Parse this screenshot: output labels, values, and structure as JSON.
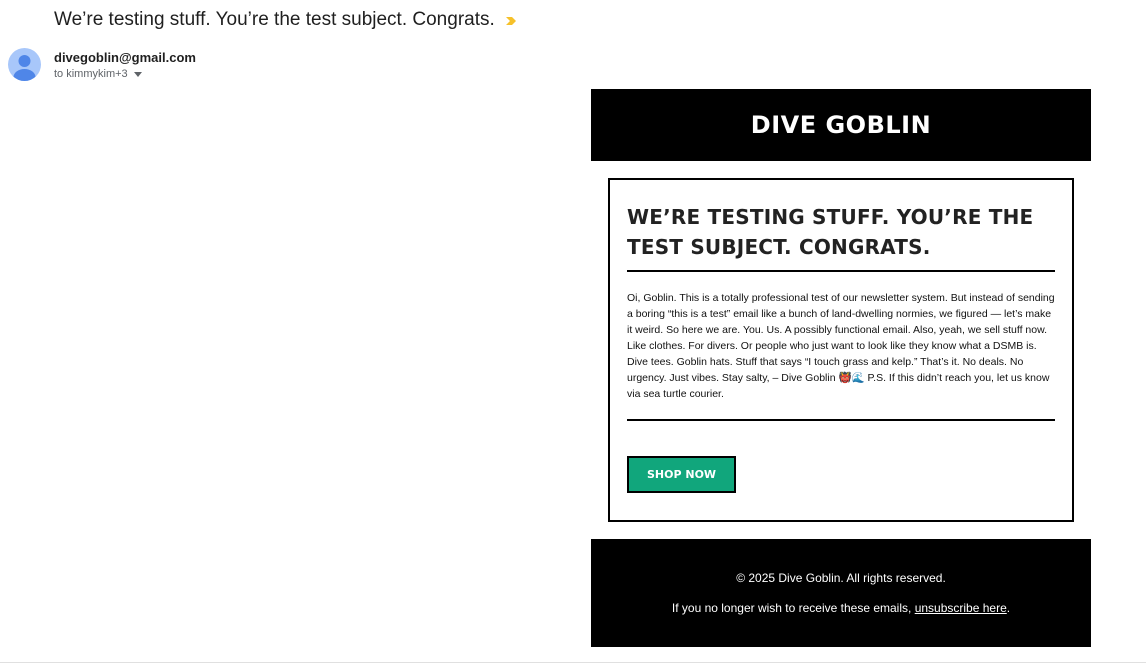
{
  "email": {
    "subject": "We’re testing stuff. You’re the test subject. Congrats.",
    "importance_icon": "importance-marker-icon",
    "importance_color": "#f6c12a",
    "sender": "divegoblin@gmail.com",
    "recipients": "to kimmykim+3",
    "avatar_color": "#a8c7fa"
  },
  "newsletter": {
    "brand": "DIVE GOBLIN",
    "headline": "WE’RE TESTING STUFF. YOU’RE THE TEST SUBJECT. CONGRATS.",
    "body": "Oi, Goblin. This is a totally professional test of our newsletter system. But instead of sending a boring “this is a test” email like a bunch of land-dwelling normies, we figured — let’s make it weird. So here we are. You. Us. A possibly functional email. Also, yeah, we sell stuff now. Like clothes. For divers. Or people who just want to look like they know what a DSMB is. Dive tees. Goblin hats. Stuff that says “I touch grass and kelp.” That’s it. No deals. No urgency. Just vibes. Stay salty, – Dive Goblin 👹🌊 P.S. If this didn’t reach you, let us know via sea turtle courier.",
    "cta_label": "SHOP NOW",
    "cta_color": "#11a67c",
    "footer": {
      "copyright": "© 2025 Dive Goblin. All rights reserved.",
      "notice_prefix": "If you no longer wish to receive these emails, ",
      "unsubscribe_label": "unsubscribe here",
      "notice_suffix": "."
    }
  }
}
